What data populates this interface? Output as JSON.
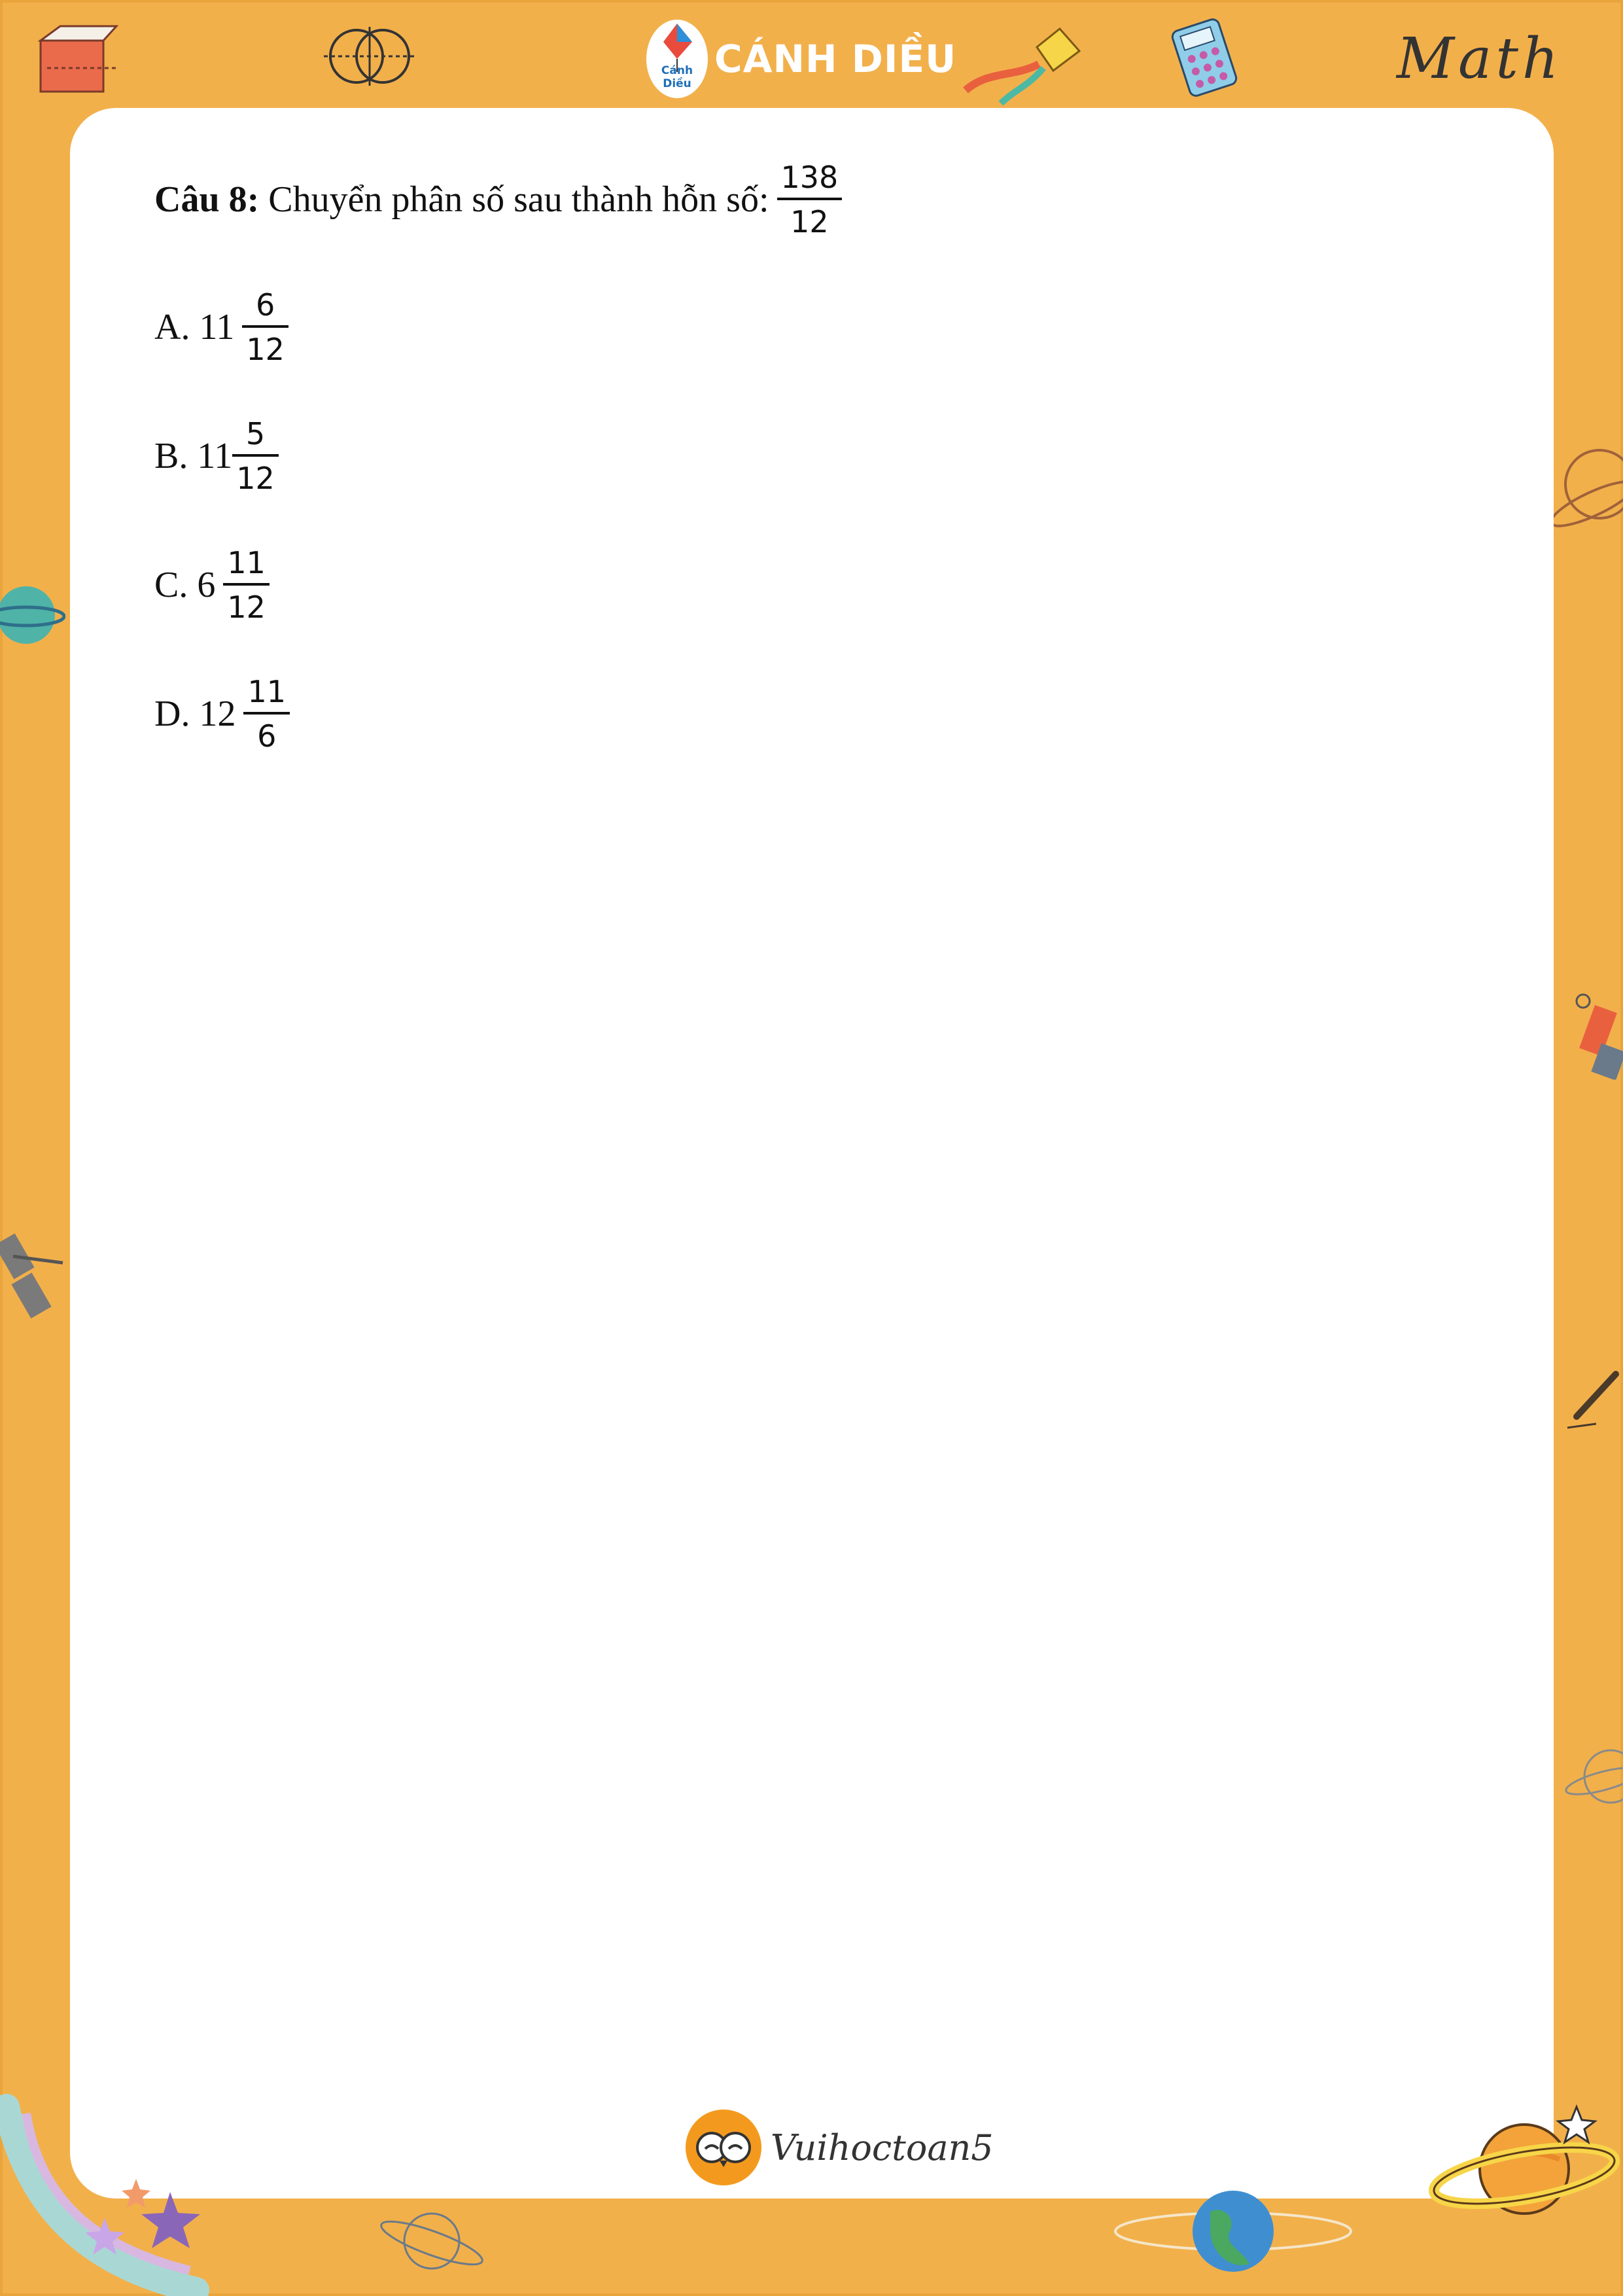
{
  "header": {
    "logo_badge": "Cánh Diều",
    "logo_title": "CÁNH DIỀU",
    "math_word": "Math"
  },
  "question": {
    "label": "Câu 8:",
    "text": "Chuyển phân số sau thành hỗn số:",
    "fraction": {
      "numerator": "138",
      "denominator": "12"
    }
  },
  "options": [
    {
      "label": "A. 11",
      "numerator": "6",
      "denominator": "12"
    },
    {
      "label": "B. 11",
      "numerator": "5",
      "denominator": "12"
    },
    {
      "label": "C. 6",
      "numerator": "11",
      "denominator": "12"
    },
    {
      "label": "D. 12",
      "numerator": "11",
      "denominator": "6"
    }
  ],
  "footer": {
    "brand": "Vuihoctoan5"
  },
  "colors": {
    "frame": "#f2b04b",
    "paper": "#ffffff",
    "text": "#111111"
  },
  "icons": [
    "ruler-box-icon",
    "venn-diagram-icon",
    "kite-icon",
    "calculator-icon",
    "planet-icon",
    "satellite-icon",
    "pencil-icon",
    "globe-icon",
    "shooting-star-icon",
    "owl-icon"
  ]
}
